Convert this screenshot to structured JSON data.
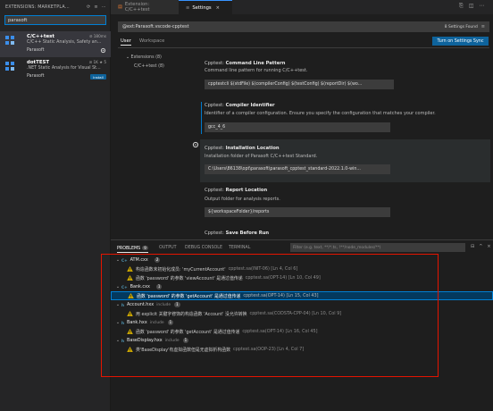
{
  "sidebar": {
    "title": "EXTENSIONS: MARKETPLA...",
    "search_value": "parasoft",
    "extensions": [
      {
        "name": "C/C++test",
        "meta": "⊘ 180ms",
        "desc": "C/C++ Static Analysis, Safety an...",
        "publisher": "Parasoft",
        "action": ""
      },
      {
        "name": "dotTEST",
        "meta": "⊘ 1K ★ 5",
        "desc": ".NET Static Analysis for Visual St...",
        "publisher": "Parasoft",
        "action": "Install"
      }
    ]
  },
  "tabs": [
    {
      "label": "Extension: C/C++test"
    },
    {
      "label": "Settings"
    }
  ],
  "settings": {
    "search_value": "@ext:Parasoft.vscode-cpptest",
    "found": "8 Settings Found",
    "scope_user": "User",
    "scope_workspace": "Workspace",
    "sync_button": "Turn on Settings Sync",
    "toc": [
      "Extensions (8)",
      "C/C++test (8)"
    ],
    "items": [
      {
        "prefix": "Cpptest: ",
        "title": "Command Line Pattern",
        "desc": "Command line pattern for running C/C++test.",
        "value": "cpptestcli $(stdFile) $(compilerConfig) $(testConfig) $(reportDir) $(wo..."
      },
      {
        "prefix": "Cpptest: ",
        "title": "Compiler Identifier",
        "desc": "Identifier of a compiler configuration. Ensure you specify the configuration that matches your compiler.",
        "value": "gcc_4_6"
      },
      {
        "prefix": "Cpptest: ",
        "title": "Installation Location",
        "desc": "Installation folder of Parasoft C/C++test Standard.",
        "value": "C:\\Users\\86138\\opt\\parasoft\\parasoft_cpptest_standard-2022.1.0-win..."
      },
      {
        "prefix": "Cpptest: ",
        "title": "Report Location",
        "desc": "Output folder for analysis reports.",
        "value": "${workspaceFolder}/reports"
      },
      {
        "prefix": "Cpptest: ",
        "title": "Save Before Run",
        "desc": "",
        "value": ""
      }
    ]
  },
  "panel": {
    "tabs": {
      "problems": "PROBLEMS",
      "problems_count": "9",
      "output": "OUTPUT",
      "debug": "DEBUG CONSOLE",
      "terminal": "TERMINAL"
    },
    "filter_placeholder": "Filter (e.g. text, **/*.ts, !**/node_modules/**)",
    "rows": [
      {
        "kind": "file",
        "name": "ATM.cxx",
        "dir": "",
        "count": "2"
      },
      {
        "kind": "problem",
        "msg": "构造函数未初始化成员: 'myCurrentAccount'",
        "src": "cpptest.sa(INIT-06) [Ln 4, Col 6]"
      },
      {
        "kind": "problem",
        "msg": "函数 'password' 的参数 'viewAccount' 是通过值传递",
        "src": "cpptest.sa(OPT-14) [Ln 10, Col 49]"
      },
      {
        "kind": "file",
        "name": "Bank.cxx",
        "dir": "",
        "count": "1"
      },
      {
        "kind": "problem",
        "sel": true,
        "msg": "函数 'password' 的参数 'getAccount' 是通过值传递",
        "src": "cpptest.sa(OPT-14) [Ln 15, Col 43]"
      },
      {
        "kind": "file",
        "name": "Account.hxx",
        "dir": "include",
        "count": "1"
      },
      {
        "kind": "problem",
        "msg": "用 explicit 关键字修饰的构造函数 'Account' 没允许转换",
        "src": "cpptest.sa(CODSTA-CPP-04) [Ln 10, Col 9]"
      },
      {
        "kind": "file",
        "name": "Bank.hxx",
        "dir": "include",
        "count": "1"
      },
      {
        "kind": "problem",
        "msg": "函数 'password' 的参数 'getAccount' 是通过值传递",
        "src": "cpptest.sa(OPT-14) [Ln 16, Col 45]"
      },
      {
        "kind": "file",
        "name": "BaseDisplay.hxx",
        "dir": "include",
        "count": "1"
      },
      {
        "kind": "problem",
        "msg": "类'BaseDisplay'有虚拟函数但是无虚拟析构函数",
        "src": "cpptest.sa(OOP-23) [Ln 4, Col 7]"
      }
    ]
  },
  "colors": {
    "accent": "#007acc",
    "button": "#0e639c",
    "warning": "#cca700",
    "highlight_box": "#e51400",
    "selection": "#04395e"
  }
}
